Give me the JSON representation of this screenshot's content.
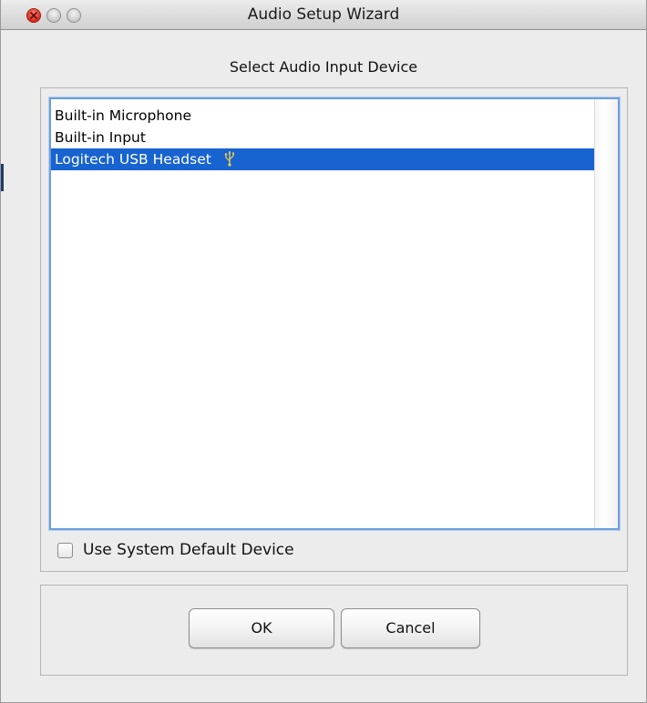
{
  "window": {
    "title": "Audio Setup Wizard"
  },
  "dialog": {
    "heading": "Select Audio Input Device",
    "devices": [
      {
        "label": "Built-in Microphone",
        "selected": false
      },
      {
        "label": "Built-in Input",
        "selected": false
      },
      {
        "label": "Logitech USB Headset",
        "selected": true,
        "icon": "usb-icon"
      }
    ],
    "use_default_label": "Use System Default Device",
    "use_default_checked": false,
    "ok_label": "OK",
    "cancel_label": "Cancel"
  },
  "colors": {
    "selection": "#1763cf",
    "close_button": "#d6291b",
    "focus_ring": "#6d9ddf"
  }
}
